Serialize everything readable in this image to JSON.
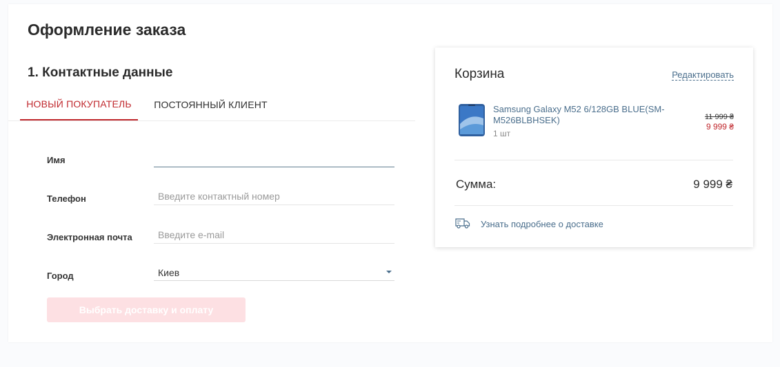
{
  "page": {
    "title": "Оформление заказа",
    "section_title": "1. Контактные данные"
  },
  "tabs": [
    {
      "label": "НОВЫЙ ПОКУПАТЕЛЬ",
      "active": true
    },
    {
      "label": "ПОСТОЯННЫЙ КЛИЕНТ",
      "active": false
    }
  ],
  "form": {
    "name": {
      "label": "Имя",
      "value": "",
      "placeholder": ""
    },
    "phone": {
      "label": "Телефон",
      "value": "",
      "placeholder": "Введите контактный номер"
    },
    "email": {
      "label": "Электронная почта",
      "value": "",
      "placeholder": "Введите e-mail"
    },
    "city": {
      "label": "Город",
      "value": "Киев"
    },
    "submit_label": "Выбрать доставку и оплату"
  },
  "cart": {
    "title": "Корзина",
    "edit_label": "Редактировать",
    "items": [
      {
        "name": "Samsung Galaxy M52 6/128GB BLUE(SM-M526BLBHSEK)",
        "quantity": "1 шт",
        "old_price": "11 999 ₴",
        "price": "9 999 ₴"
      }
    ],
    "sum_label": "Сумма:",
    "sum_value": "9 999 ₴",
    "delivery_link": "Узнать подробнее о доставке"
  },
  "colors": {
    "accent": "#c0282d",
    "link": "#4a6e8c",
    "submit_disabled_bg": "#fde0e3"
  },
  "icons": {
    "product_image": "phone-image",
    "delivery": "truck-icon",
    "select_caret": "caret-down-icon"
  }
}
